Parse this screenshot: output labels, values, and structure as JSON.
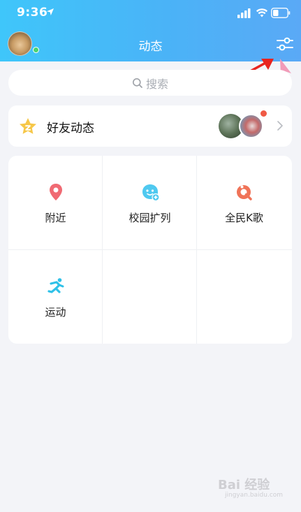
{
  "status_bar": {
    "time": "9:36"
  },
  "header": {
    "title": "动态"
  },
  "search": {
    "placeholder": "搜索"
  },
  "friends_feed": {
    "label": "好友动态"
  },
  "grid": {
    "items": [
      {
        "label": "附近",
        "icon": "location-pin-icon"
      },
      {
        "label": "校园扩列",
        "icon": "campus-friends-icon"
      },
      {
        "label": "全民K歌",
        "icon": "karaoke-icon"
      },
      {
        "label": "运动",
        "icon": "running-icon"
      }
    ]
  },
  "watermark": {
    "brand": "Bai 经验",
    "url": "jingyan.baidu.com"
  },
  "colors": {
    "header_gradient_start": "#3fc6fa",
    "header_gradient_end": "#5aa9f6",
    "page_background": "#f3f4f8",
    "online_dot": "#49d36f",
    "notification_dot": "#f05a45",
    "annotation_arrow": "#e8231f",
    "cursor": "#f29bb8"
  }
}
